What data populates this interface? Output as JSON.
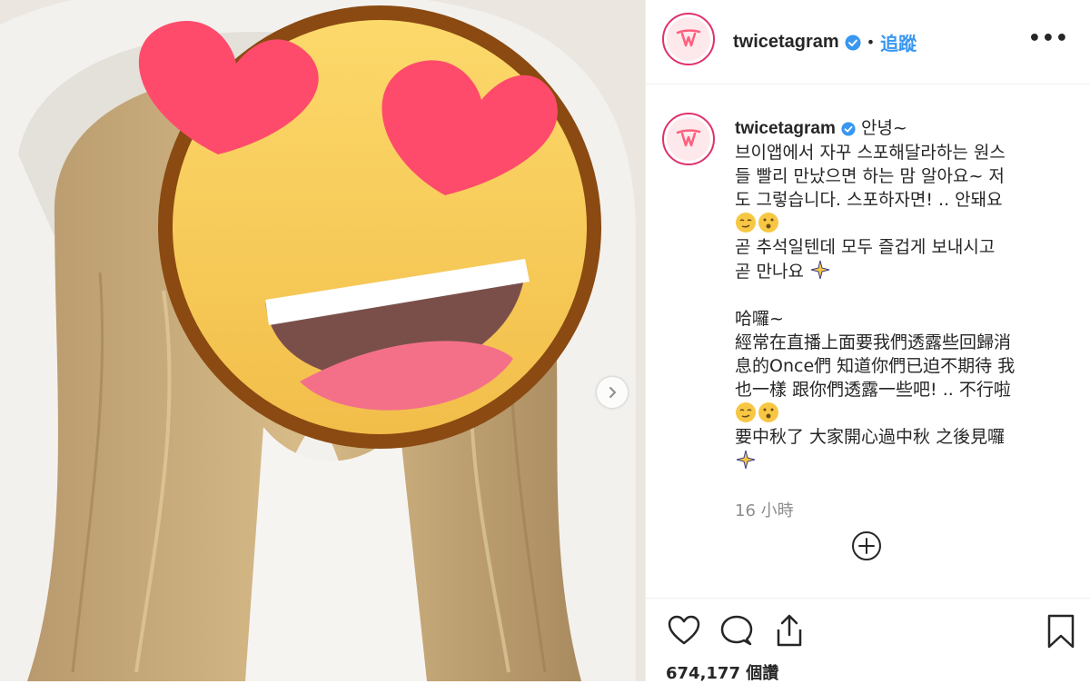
{
  "post": {
    "username": "twicetagram",
    "follow_label": "追蹤",
    "more_label": "•••",
    "separator": "•",
    "caption_greeting": "안녕~",
    "caption_lines": [
      "브이앱에서 자꾸 스포해달라하는 원스",
      "들 빨리 만났으면 하는 맘 알아요~ 저",
      "도 그렇습니다. 스포하자면! .. 안돼요",
      "",
      "곧 추석일텐데 모두 즐겁게 보내시고",
      "곧 만나요",
      "",
      "哈囉~",
      "經常在直播上面要我們透露些回歸消",
      "息的Once們 知道你們已迫不期待 我",
      "也一樣 跟你們透露一些吧! .. 不行啦",
      "",
      "要中秋了 大家開心過中秋 之後見囉",
      ""
    ],
    "time": "16 小時",
    "likes": "674,177 個讚"
  },
  "icons": {
    "like": "heart-outline-icon",
    "comment": "comment-bubble-icon",
    "share": "share-icon",
    "save": "bookmark-icon",
    "more_comments": "plus-circle-icon",
    "next": "chevron-right-icon"
  },
  "colors": {
    "link": "#3897f0",
    "verified": "#3897f0",
    "text": "#262626",
    "muted": "#8e8e8e",
    "avatar_ring": "#e1306c",
    "brand": "#ff5f7e"
  }
}
